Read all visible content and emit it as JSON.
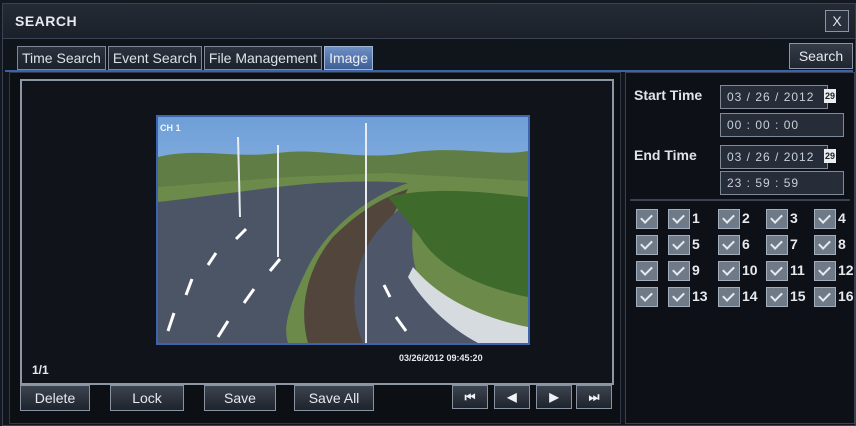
{
  "window": {
    "title": "SEARCH",
    "close_glyph": "X"
  },
  "tabs": [
    {
      "label": "Time Search",
      "active": false
    },
    {
      "label": "Event Search",
      "active": false
    },
    {
      "label": "File Management",
      "active": false
    },
    {
      "label": "Image",
      "active": true
    }
  ],
  "search_button": "Search",
  "preview": {
    "channel_label": "CH 1",
    "timestamp": "03/26/2012 09:45:20",
    "page": "1/1",
    "image_icon": "highway-photo"
  },
  "actions": {
    "delete": "Delete",
    "lock": "Lock",
    "save": "Save",
    "save_all": "Save All"
  },
  "playback": {
    "first": "⏮",
    "prev": "◀",
    "next": "▶",
    "last": "⏭"
  },
  "time_filter": {
    "start_label": "Start Time",
    "start_date": "03 / 26 / 2012",
    "start_time": "00 : 00 : 00",
    "end_label": "End Time",
    "end_date": "03 / 26 / 2012",
    "end_time": "23 : 59 : 59",
    "calendar_glyph": "29"
  },
  "channels": {
    "all_checked": true,
    "list": [
      {
        "num": "1",
        "checked": true
      },
      {
        "num": "2",
        "checked": true
      },
      {
        "num": "3",
        "checked": true
      },
      {
        "num": "4",
        "checked": true
      },
      {
        "num": "5",
        "checked": true
      },
      {
        "num": "6",
        "checked": true
      },
      {
        "num": "7",
        "checked": true
      },
      {
        "num": "8",
        "checked": true
      },
      {
        "num": "9",
        "checked": true
      },
      {
        "num": "10",
        "checked": true
      },
      {
        "num": "11",
        "checked": true
      },
      {
        "num": "12",
        "checked": true
      },
      {
        "num": "13",
        "checked": true
      },
      {
        "num": "14",
        "checked": true
      },
      {
        "num": "15",
        "checked": true
      },
      {
        "num": "16",
        "checked": true
      }
    ]
  },
  "colors": {
    "accent": "#3e62a6",
    "active_tab": "#5a7bb3",
    "background": "#10141b"
  }
}
